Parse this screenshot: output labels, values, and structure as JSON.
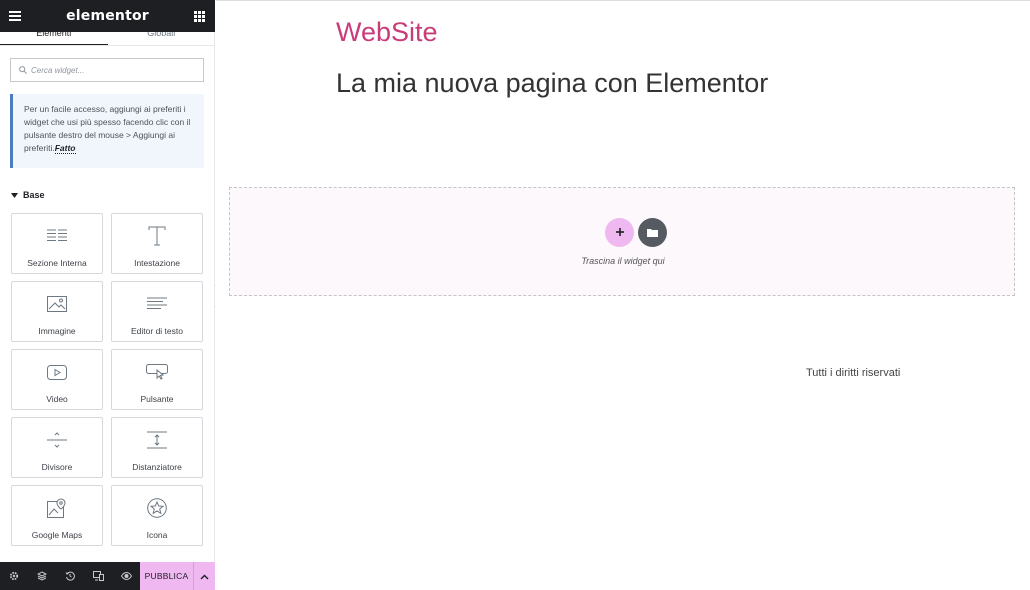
{
  "sidebar": {
    "logo": "elementor",
    "tabs": [
      {
        "label": "Elementi",
        "active": true
      },
      {
        "label": "Globali",
        "active": false
      }
    ],
    "search": {
      "placeholder": "Cerca widget..."
    },
    "note": {
      "text": "Per un facile accesso, aggiungi ai preferiti i widget che usi più spesso facendo clic con il pulsante destro del mouse > Aggiungi ai preferiti.",
      "done_label": "Fatto"
    },
    "category": "Base",
    "widgets": [
      {
        "label": "Sezione Interna",
        "icon": "inner-section-icon"
      },
      {
        "label": "Intestazione",
        "icon": "heading-icon"
      },
      {
        "label": "Immagine",
        "icon": "image-icon"
      },
      {
        "label": "Editor di testo",
        "icon": "text-editor-icon"
      },
      {
        "label": "Video",
        "icon": "video-icon"
      },
      {
        "label": "Pulsante",
        "icon": "button-icon"
      },
      {
        "label": "Divisore",
        "icon": "divider-icon"
      },
      {
        "label": "Distanziatore",
        "icon": "spacer-icon"
      },
      {
        "label": "Google Maps",
        "icon": "google-maps-icon"
      },
      {
        "label": "Icona",
        "icon": "star-icon"
      }
    ],
    "footer": {
      "publish_label": "PUBBLICA",
      "icons": [
        "settings-icon",
        "layers-icon",
        "history-icon",
        "responsive-icon",
        "preview-icon"
      ]
    }
  },
  "canvas": {
    "site_title": "WebSite",
    "page_title": "La mia nuova pagina con Elementor",
    "dropzone_text": "Trascina il widget qui",
    "footer_text": "Tutti i diritti riservati"
  },
  "colors": {
    "accent_pink": "#f0b8f0",
    "site_title": "#c93c7a",
    "dark": "#1d1f23",
    "note_border": "#4a7ebd"
  }
}
